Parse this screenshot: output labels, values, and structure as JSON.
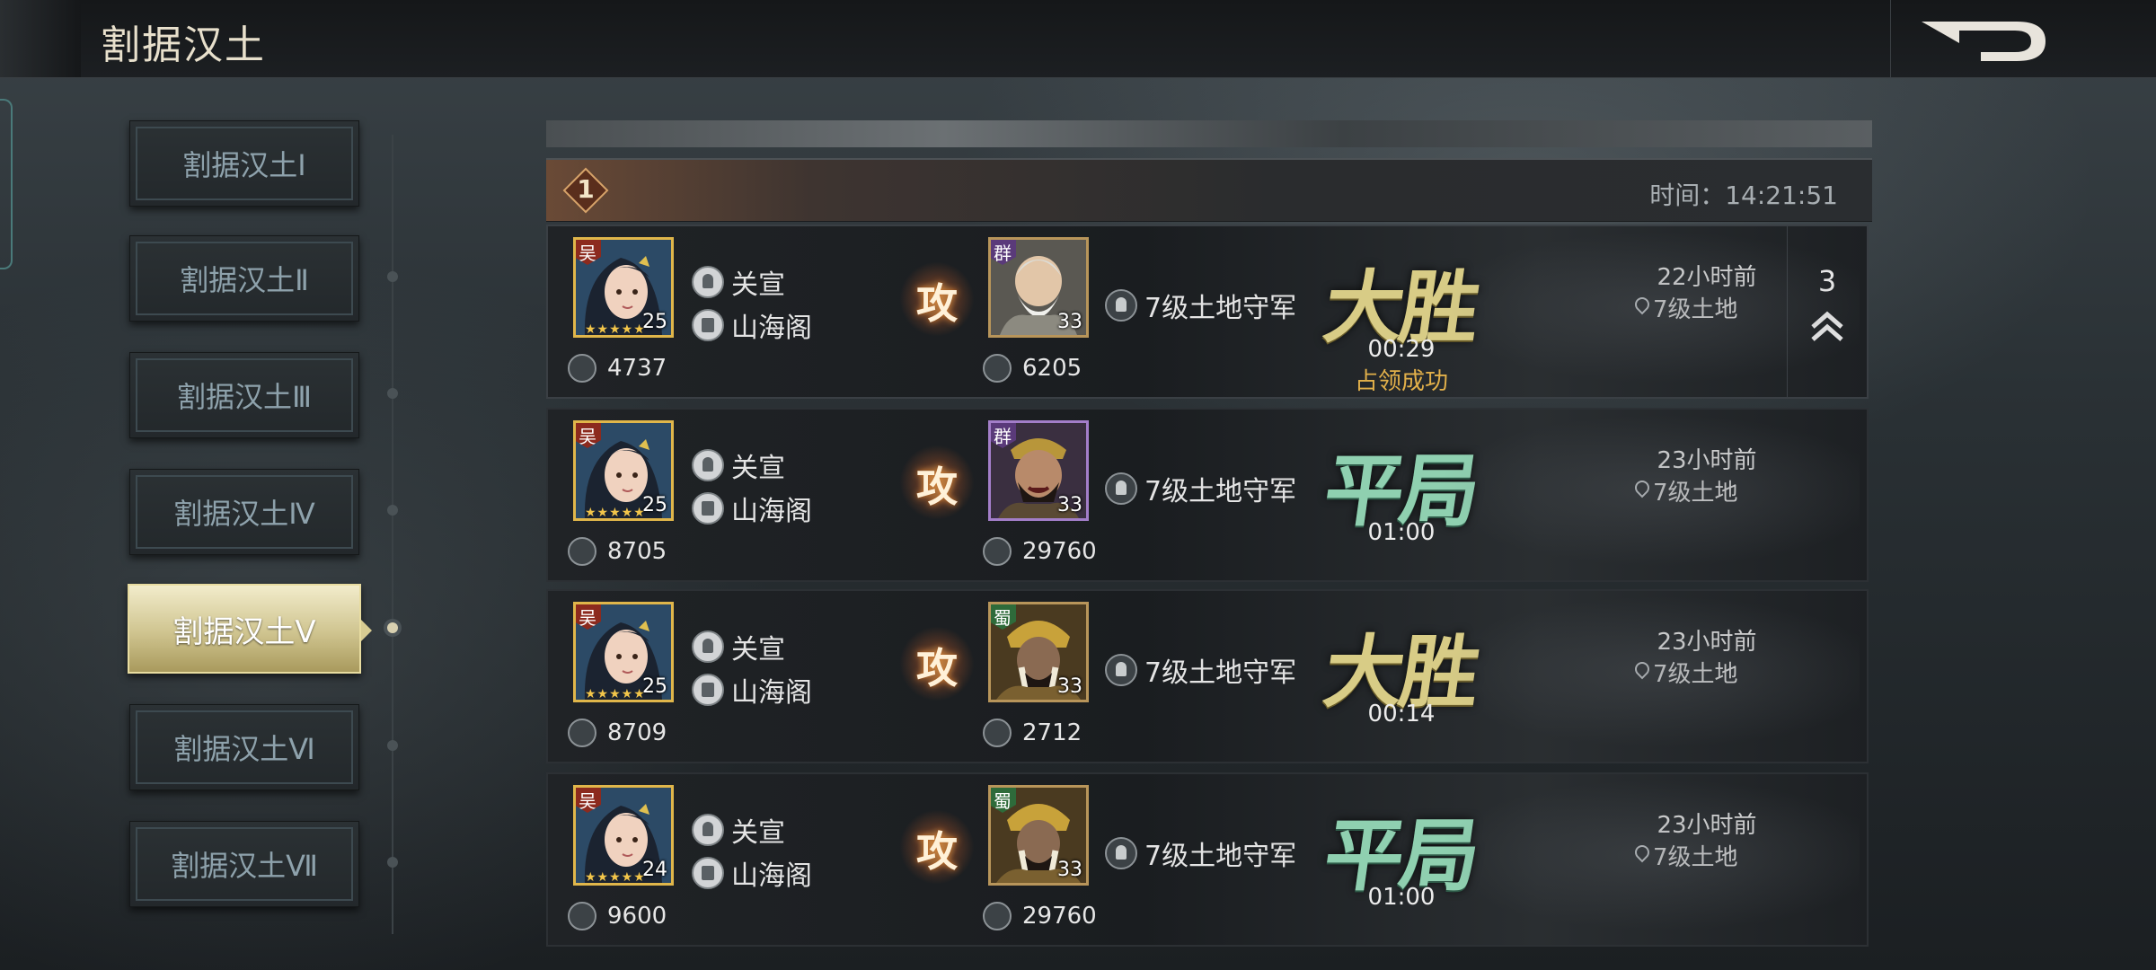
{
  "header": {
    "title": "割据汉土",
    "back_icon": "return-arrow-icon"
  },
  "sidebar": {
    "items": [
      {
        "label": "割据汉土Ⅰ",
        "active": false
      },
      {
        "label": "割据汉土Ⅱ",
        "active": false
      },
      {
        "label": "割据汉土Ⅲ",
        "active": false
      },
      {
        "label": "割据汉土Ⅳ",
        "active": false
      },
      {
        "label": "割据汉土Ⅴ",
        "active": true
      },
      {
        "label": "割据汉土Ⅵ",
        "active": false
      },
      {
        "label": "割据汉土Ⅶ",
        "active": false
      }
    ]
  },
  "round": {
    "number": "1",
    "time_label": "时间：14:21:51"
  },
  "battles": [
    {
      "attacker": {
        "faction": "吴",
        "level": "25",
        "name": "关宣",
        "alliance": "山海阁",
        "power": "4737"
      },
      "action": "攻",
      "defender": {
        "faction": "群",
        "level": "33",
        "name": "7级土地守军",
        "power": "6205"
      },
      "result": "大胜",
      "result_type": "win",
      "duration": "00:29",
      "extra": "占领成功",
      "ago": "22小时前",
      "location": "7级土地",
      "expand_count": "3"
    },
    {
      "attacker": {
        "faction": "吴",
        "level": "25",
        "name": "关宣",
        "alliance": "山海阁",
        "power": "8705"
      },
      "action": "攻",
      "defender": {
        "faction": "群",
        "level": "33",
        "name": "7级土地守军",
        "power": "29760"
      },
      "result": "平局",
      "result_type": "draw",
      "duration": "01:00",
      "extra": "",
      "ago": "23小时前",
      "location": "7级土地"
    },
    {
      "attacker": {
        "faction": "吴",
        "level": "25",
        "name": "关宣",
        "alliance": "山海阁",
        "power": "8709"
      },
      "action": "攻",
      "defender": {
        "faction": "蜀",
        "level": "33",
        "name": "7级土地守军",
        "power": "2712"
      },
      "result": "大胜",
      "result_type": "win",
      "duration": "00:14",
      "extra": "",
      "ago": "23小时前",
      "location": "7级土地"
    },
    {
      "attacker": {
        "faction": "吴",
        "level": "24",
        "name": "关宣",
        "alliance": "山海阁",
        "power": "9600"
      },
      "action": "攻",
      "defender": {
        "faction": "蜀",
        "level": "33",
        "name": "7级土地守军",
        "power": "29760"
      },
      "result": "平局",
      "result_type": "draw",
      "duration": "01:00",
      "extra": "",
      "ago": "23小时前",
      "location": "7级土地"
    }
  ],
  "colors": {
    "win": "#d8cc86",
    "draw": "#8fd0b0",
    "occupied": "#e2b04a",
    "active_tab": "#cfc48f"
  }
}
